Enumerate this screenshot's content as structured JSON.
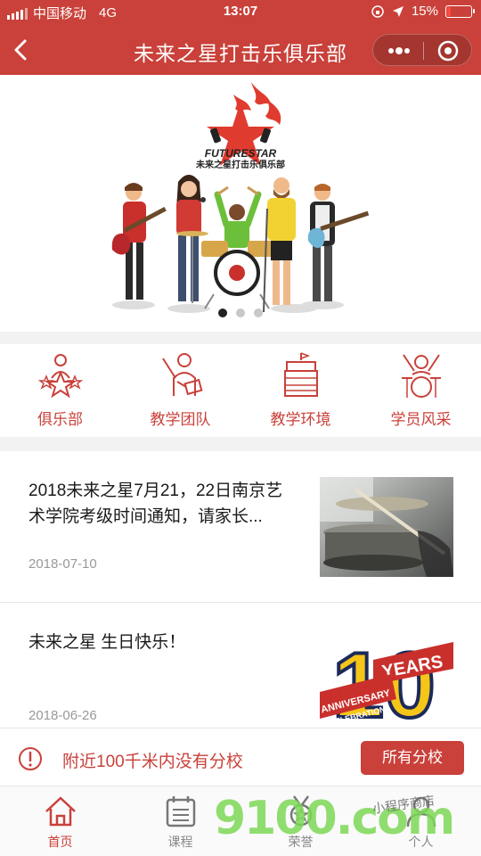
{
  "status_bar": {
    "carrier": "中国移动",
    "network": "4G",
    "time": "13:07",
    "battery": "15%",
    "battery_level": 0.15
  },
  "nav": {
    "title": "未来之星打击乐俱乐部"
  },
  "banner": {
    "logo_text_en": "FUTURESTAR",
    "logo_text_cn": "未来之星打击乐俱乐部",
    "slide_count": 3,
    "active_slide": 0
  },
  "menu": [
    {
      "label": "俱乐部",
      "icon": "club-icon"
    },
    {
      "label": "教学团队",
      "icon": "teacher-icon"
    },
    {
      "label": "教学环境",
      "icon": "building-icon"
    },
    {
      "label": "学员风采",
      "icon": "drummer-icon"
    }
  ],
  "articles": [
    {
      "title": "2018未来之星7月21，22日南京艺术学院考级时间通知，请家长...",
      "date": "2018-07-10",
      "thumb": "drum-photo"
    },
    {
      "title": "未来之星 生日快乐！",
      "date": "2018-06-26",
      "thumb": "anniversary-logo",
      "thumb_number": "10",
      "thumb_years": "YEARS",
      "thumb_ribbon": "ANNIVERSARY",
      "thumb_sub": "CELEBRATION"
    }
  ],
  "notice": {
    "text": "附近100千米内没有分校",
    "button": "所有分校"
  },
  "tabs": [
    {
      "label": "首页",
      "icon": "home-icon",
      "active": true
    },
    {
      "label": "课程",
      "icon": "calendar-icon",
      "active": false
    },
    {
      "label": "荣誉",
      "icon": "medal-icon",
      "active": false
    },
    {
      "label": "个人",
      "icon": "person-icon",
      "active": false
    }
  ],
  "watermark": {
    "text": "9100.com",
    "subtext": "小程序商店"
  },
  "colors": {
    "brand": "#c9413a",
    "muted": "#999999"
  }
}
